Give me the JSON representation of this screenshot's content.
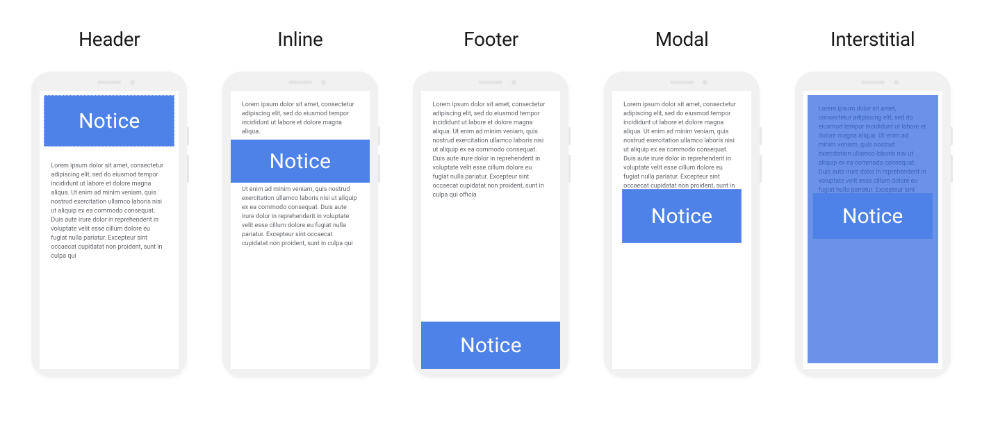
{
  "notice_label": "Notice",
  "examples": [
    {
      "title": "Header"
    },
    {
      "title": "Inline"
    },
    {
      "title": "Footer"
    },
    {
      "title": "Modal"
    },
    {
      "title": "Interstitial"
    }
  ],
  "lorem": {
    "header": "Lorem ipsum dolor sit amet, consectetur adipiscing elit, sed do eiusmod tempor incididunt ut labore et dolore magna aliqua. Ut enim ad minim veniam, quis nostrud exercitation ullamco laboris nisi ut aliquip ex ea commodo consequat. Duis aute irure dolor in reprehenderit in voluptate velit esse cillum dolore eu fugiat nulla pariatur. Excepteur sint occaecat cupidatat non proident, sunt in culpa qui",
    "inline_top": "Lorem ipsum dolor sit amet, consectetur adipiscing elit, sed do eiusmod tempor incididunt ut labore et dolore magna aliqua.",
    "inline_bottom": "Ut enim ad minim veniam, quis nostrud exercitation ullamco laboris nisi ut aliquip ex ea commodo consequat. Duis aute irure dolor in reprehenderit in voluptate velit esse cillum dolore eu fugiat nulla pariatur. Excepteur sint occaecat cupidatat non proident, sunt in culpa qui",
    "footer": "Lorem ipsum dolor sit amet, consectetur adipiscing elit, sed do eiusmod tempor incididunt ut labore et dolore magna aliqua. Ut enim ad minim veniam, quis nostrud exercitation ullamco laboris nisi ut aliquip ex ea commodo consequat. Duis aute irure dolor in reprehenderit in voluptate velit esse cillum dolore eu fugiat nulla pariatur. Excepteur sint occaecat cupidatat non proident, sunt in culpa qui officia",
    "modal": "Lorem ipsum dolor sit amet, consectetur adipiscing elit, sed do eiusmod tempor incididunt ut labore et dolore magna aliqua. Ut enim ad minim veniam, quis nostrud exercitation ullamco laboris nisi ut aliquip ex ea commodo consequat. Duis aute irure dolor in reprehenderit in voluptate velit esse cillum dolore eu fugiat nulla pariatur. Excepteur sint occaecat cupidatat non proident, sunt in culpa qui officia deserunt mollit anim id est laborum.",
    "interstitial": "Lorem ipsum dolor sit amet, consectetur adipiscing elit, sed do eiusmod tempor incididunt ut labore et dolore magna aliqua. Ut enim ad minim veniam, quis nostrud exercitation ullamco laboris nisi ut aliquip ex ea commodo consequat. Duis aute irure dolor in reprehenderit in voluptate velit esse cillum dolore eu fugiat nulla pariatur. Excepteur sint occaecat cupidatat non proident, sunt in culpa qui officia deserunt mollit anim id est laborum."
  }
}
